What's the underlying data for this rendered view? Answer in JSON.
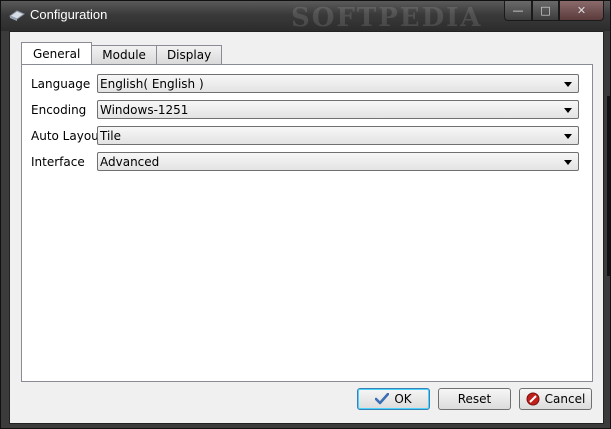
{
  "window": {
    "title": "Configuration",
    "watermark": "SOFTPEDIA",
    "caption": {
      "minimize": "—",
      "maximize": "□",
      "close": "✕"
    }
  },
  "tabs": [
    {
      "label": "General",
      "active": true
    },
    {
      "label": "Module",
      "active": false
    },
    {
      "label": "Display",
      "active": false
    }
  ],
  "fields": {
    "language": {
      "label": "Language",
      "value": "English( English )"
    },
    "encoding": {
      "label": "Encoding",
      "value": "Windows-1251"
    },
    "auto_layout": {
      "label": "Auto Layout",
      "value": "Tile"
    },
    "interface": {
      "label": "Interface",
      "value": "Advanced"
    }
  },
  "buttons": {
    "ok": "OK",
    "reset": "Reset",
    "cancel": "Cancel"
  },
  "icons": {
    "app": "config-icon",
    "ok": "checkmark-icon",
    "cancel": "cancel-icon"
  },
  "colors": {
    "titlebar": "#3a3a3a",
    "ok_check": "#3b6fb6",
    "cancel_red": "#c0201c"
  }
}
